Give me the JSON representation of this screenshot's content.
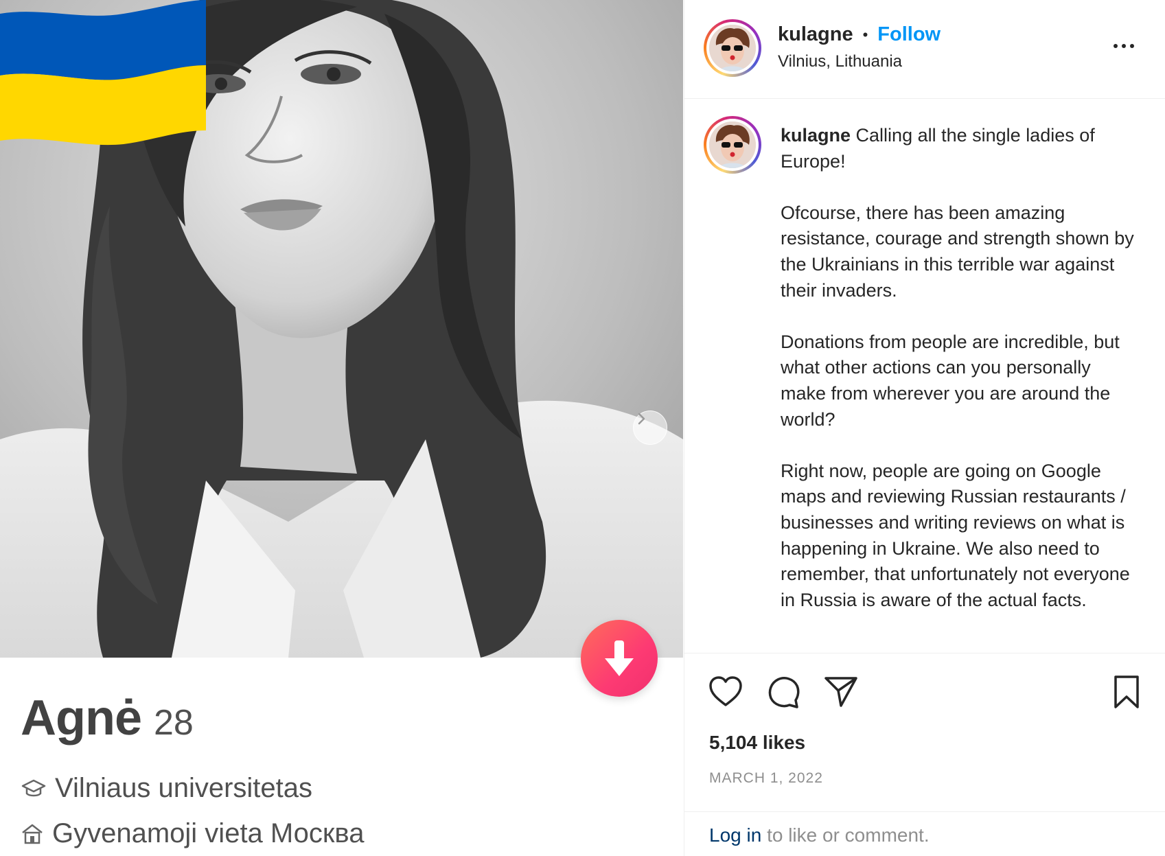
{
  "tinder_card": {
    "name": "Agnė",
    "age": "28",
    "school": "Vilniaus universitetas",
    "residence": "Gyvenamoji vieta Москва",
    "icons": {
      "school": "graduation-cap-icon",
      "residence": "house-icon",
      "nope": "arrow-down-icon",
      "next": "chevron-right-icon",
      "flag": "ukraine-flag-icon"
    },
    "colors": {
      "flag_blue": "#0057b8",
      "flag_yellow": "#ffd700",
      "button_start": "#ff6d5a",
      "button_end": "#f0306e"
    }
  },
  "post": {
    "header": {
      "username": "kulagne",
      "separator": "•",
      "follow_label": "Follow",
      "location": "Vilnius, Lithuania"
    },
    "caption": {
      "username": "kulagne",
      "paragraphs": [
        "Calling all the single ladies of Europe!",
        "Ofcourse, there has been amazing resistance, courage and strength shown by the Ukrainians in this terrible war against their invaders.",
        "Donations from people are incredible, but what other actions can you personally make from wherever you are around the world?",
        "Right now, people are going on Google maps and reviewing Russian restaurants / businesses and writing reviews on what is happening in Ukraine. We also need to remember, that unfortunately not everyone in Russia is aware of the actual facts."
      ]
    },
    "actions": {
      "like": "heart-icon",
      "comment": "comment-icon",
      "share": "paper-plane-icon",
      "save": "bookmark-icon"
    },
    "likes": "5,104 likes",
    "date": "MARCH 1, 2022",
    "login": {
      "link": "Log in",
      "text": "to like or comment."
    },
    "colors": {
      "follow": "#0095f6",
      "login_link": "#00376b",
      "muted": "#8e8e8e"
    }
  }
}
